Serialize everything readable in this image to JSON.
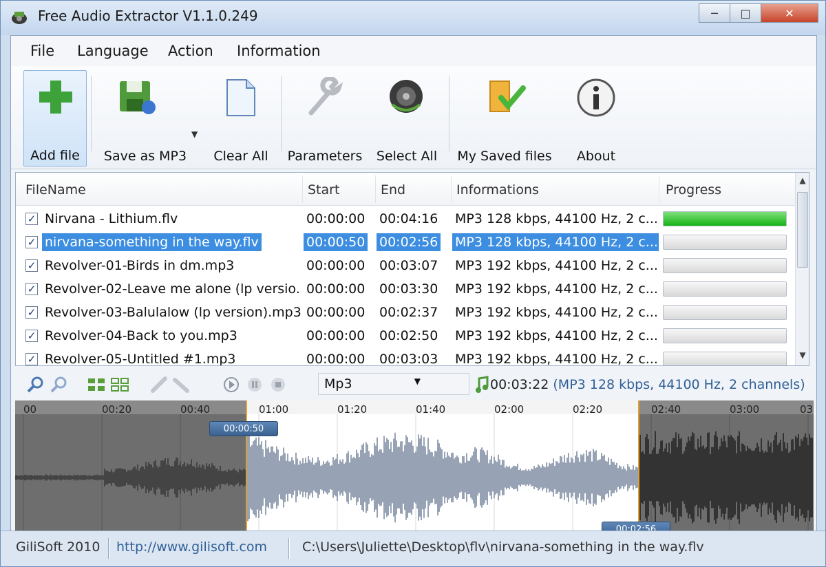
{
  "window": {
    "title": "Free Audio Extractor V1.1.0.249",
    "controls": {
      "minimize": "─",
      "maximize": "□",
      "close": "✕"
    }
  },
  "menu": [
    "File",
    "Language",
    "Action",
    "Information"
  ],
  "toolbar": {
    "add_file": "Add file",
    "save_as": "Save as MP3",
    "clear_all": "Clear All",
    "parameters": "Parameters",
    "select_all": "Select All",
    "my_saved_files": "My Saved files",
    "about": "About"
  },
  "list": {
    "headers": {
      "filename": "FileName",
      "start": "Start",
      "end": "End",
      "info": "Informations",
      "progress": "Progress"
    },
    "rows": [
      {
        "checked": true,
        "name": "Nirvana - Lithium.flv",
        "start": "00:00:00",
        "end": "00:04:16",
        "info": "MP3 128 kbps, 44100 Hz, 2 c...",
        "progress": 1.0,
        "selected": false
      },
      {
        "checked": true,
        "name": "nirvana-something in the way.flv",
        "start": "00:00:50",
        "end": "00:02:56",
        "info": "MP3 128 kbps, 44100 Hz, 2 c...",
        "progress": 0,
        "selected": true
      },
      {
        "checked": true,
        "name": "Revolver-01-Birds in dm.mp3",
        "start": "00:00:00",
        "end": "00:03:07",
        "info": "MP3 192 kbps, 44100 Hz, 2 c...",
        "progress": 0,
        "selected": false
      },
      {
        "checked": true,
        "name": "Revolver-02-Leave me alone (lp versio...",
        "start": "00:00:00",
        "end": "00:03:30",
        "info": "MP3 192 kbps, 44100 Hz, 2 c...",
        "progress": 0,
        "selected": false
      },
      {
        "checked": true,
        "name": "Revolver-03-Balulalow (lp version).mp3",
        "start": "00:00:00",
        "end": "00:02:37",
        "info": "MP3 192 kbps, 44100 Hz, 2 c...",
        "progress": 0,
        "selected": false
      },
      {
        "checked": true,
        "name": "Revolver-04-Back to you.mp3",
        "start": "00:00:00",
        "end": "00:02:50",
        "info": "MP3 192 kbps, 44100 Hz, 2 c...",
        "progress": 0,
        "selected": false
      },
      {
        "checked": true,
        "name": "Revolver-05-Untitled #1.mp3",
        "start": "00:00:00",
        "end": "00:03:03",
        "info": "MP3 192 kbps, 44100 Hz, 2 c...",
        "progress": 0,
        "selected": false
      }
    ]
  },
  "wave_toolbar": {
    "format": "Mp3",
    "file_info_time": "00:03:22",
    "file_info_rest": "(MP3 128 kbps, 44100 Hz, 2 channels)"
  },
  "waveform": {
    "ticks": [
      "00",
      "00:20",
      "00:40",
      "01:00",
      "01:20",
      "01:40",
      "02:00",
      "02:20",
      "02:40",
      "03:00",
      "03"
    ],
    "start_marker": "00:00:50",
    "end_marker": "00:02:56"
  },
  "statusbar": {
    "company": "GiliSoft 2010",
    "url": "http://www.gilisoft.com",
    "path": "C:\\Users\\Juliette\\Desktop\\flv\\nirvana-something in the way.flv"
  },
  "colors": {
    "selection": "#3d8ee0",
    "progress_green": "#17b316"
  }
}
